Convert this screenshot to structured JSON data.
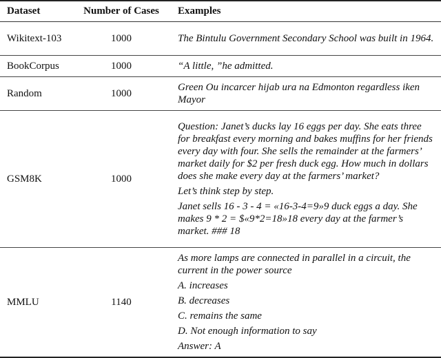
{
  "table": {
    "headers": [
      "Dataset",
      "Number of Cases",
      "Examples"
    ],
    "rows": [
      {
        "dataset": "Wikitext-103",
        "cases": "1000",
        "examples": [
          "The Bintulu Government Secondary School was built in 1964."
        ]
      },
      {
        "dataset": "BookCorpus",
        "cases": "1000",
        "examples": [
          "“A little, ”he admitted."
        ]
      },
      {
        "dataset": "Random",
        "cases": "1000",
        "examples": [
          "Green Ou incarcer hijab ura na Edmonton regardless iken Mayor"
        ]
      },
      {
        "dataset": "GSM8K",
        "cases": "1000",
        "examples": [
          "Question: Janet’s ducks lay 16 eggs per day. She eats three for breakfast every morning and bakes muffins for her friends every day with four. She sells the remainder at the farmers’ market daily for $2 per fresh duck egg. How much in dollars does she make every day at the farmers’ market?",
          "Let’s think step by step.",
          "Janet sells 16 - 3 - 4 = «16-3-4=9»9 duck eggs a day. She makes 9 * 2 = $«9*2=18»18 every day at the farmer’s market. ### 18"
        ]
      },
      {
        "dataset": "MMLU",
        "cases": "1140",
        "examples": [
          "As more lamps are connected in parallel in a circuit, the current in the power source",
          "A. increases",
          "B. decreases",
          "C. remains the same",
          "D. Not enough information to say",
          "Answer: A"
        ]
      }
    ]
  }
}
